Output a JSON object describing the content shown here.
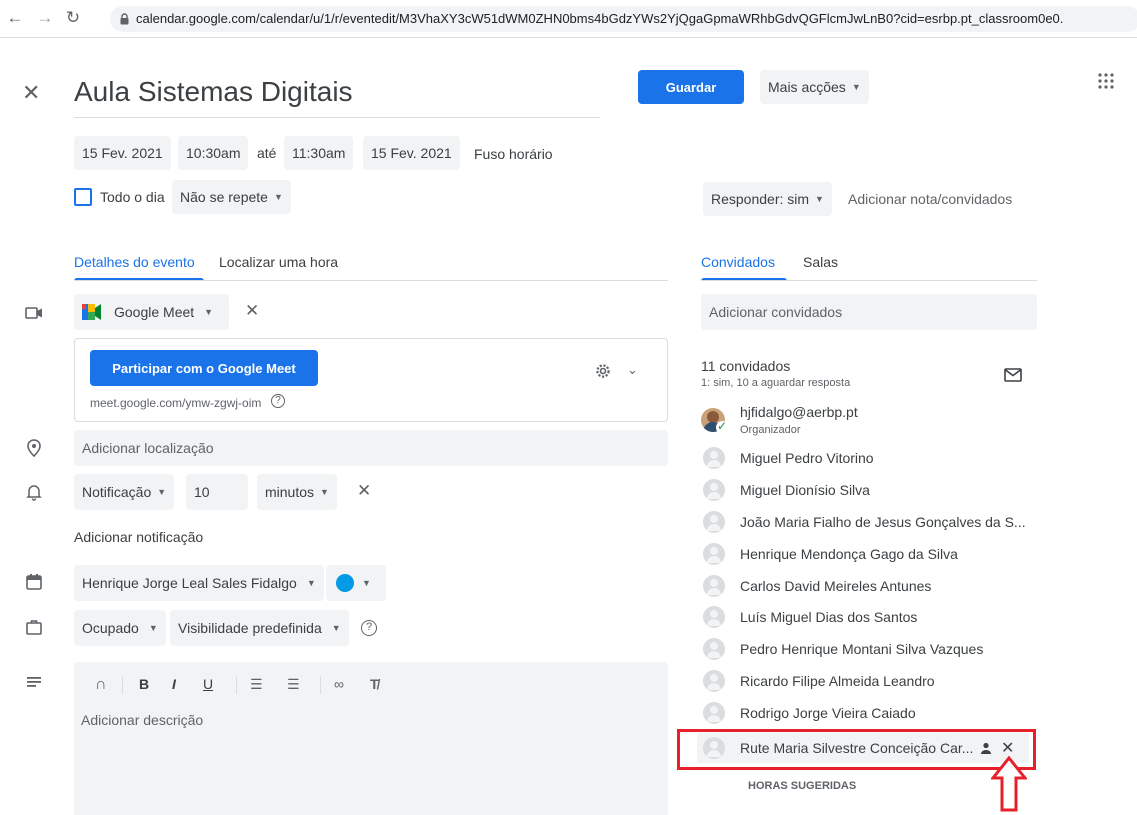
{
  "browser": {
    "url": "calendar.google.com/calendar/u/1/r/eventedit/M3VhaXY3cW51dWM0ZHN0bms4bGdzYWs2YjQgaGpmaWRhbGdvQGFlcmJwLnB0?cid=esrbp.pt_classroom0e0."
  },
  "event": {
    "title": "Aula Sistemas Digitais",
    "save_label": "Guardar",
    "more_actions": "Mais acções",
    "start_date": "15 Fev. 2021",
    "start_time": "10:30am",
    "until": "até",
    "end_time": "11:30am",
    "end_date": "15 Fev. 2021",
    "timezone": "Fuso horário",
    "all_day": "Todo o dia",
    "repeat": "Não se repete",
    "respond": "Responder: sim",
    "add_note": "Adicionar nota/convidados"
  },
  "tabs_left": {
    "details": "Detalhes do evento",
    "find_time": "Localizar uma hora"
  },
  "tabs_right": {
    "guests": "Convidados",
    "rooms": "Salas"
  },
  "meet": {
    "name": "Google Meet",
    "join_label": "Participar com o Google Meet",
    "link": "meet.google.com/ymw-zgwj-oim"
  },
  "location_placeholder": "Adicionar localização",
  "notification": {
    "type": "Notificação",
    "value": "10",
    "unit": "minutos",
    "add_label": "Adicionar notificação"
  },
  "calendar_owner": "Henrique Jorge Leal Sales Fidalgo",
  "calendar_color": "#039be5",
  "busy": "Ocupado",
  "visibility": "Visibilidade predefinida",
  "description_placeholder": "Adicionar descrição",
  "guests": {
    "add_placeholder": "Adicionar convidados",
    "count": "11 convidados",
    "summary": "1: sim, 10 a aguardar resposta",
    "organizer_email": "hjfidalgo@aerbp.pt",
    "organizer_role": "Organizador",
    "list": [
      "Miguel Pedro Vitorino",
      "Miguel Dionísio Silva",
      "João Maria Fialho de Jesus Gonçalves da S...",
      "Henrique Mendonça Gago da Silva",
      "Carlos David Meireles Antunes",
      "Luís Miguel Dias dos Santos",
      "Pedro Henrique Montani Silva Vazques",
      "Ricardo Filipe Almeida Leandro",
      "Rodrigo Jorge Vieira Caiado"
    ],
    "highlighted": "Rute Maria Silvestre Conceição Car...",
    "suggested": "HORAS SUGERIDAS"
  },
  "colors": {
    "accent": "#1a73e8",
    "highlight": "#e8202a"
  }
}
